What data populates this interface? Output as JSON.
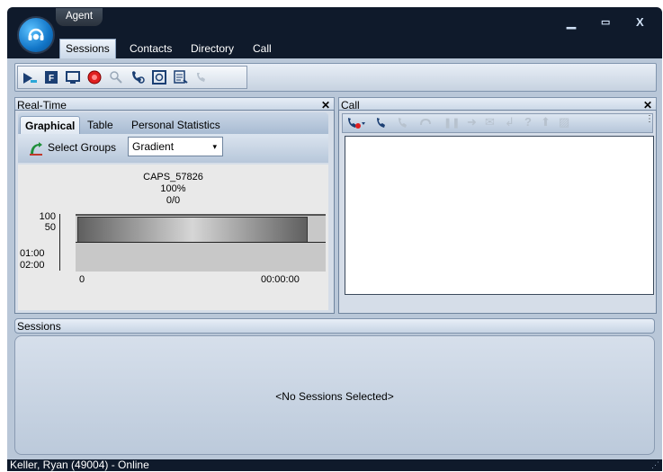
{
  "app": {
    "title": "Agent"
  },
  "menu_tabs": [
    "Sessions",
    "Contacts",
    "Directory",
    "Call Log"
  ],
  "realtime": {
    "header": "Real-Time",
    "subtabs": [
      "Graphical",
      "Table",
      "Personal Statistics"
    ],
    "select_groups_label": "Select Groups",
    "combo_value": "Gradient",
    "graph": {
      "name": "CAPS_57826",
      "percent": "100%",
      "ratio": "0/0",
      "y_ticks": [
        "100",
        "50",
        "01:00",
        "02:00"
      ],
      "x_left": "0",
      "x_right": "00:00:00"
    }
  },
  "call": {
    "header": "Call"
  },
  "sessions": {
    "header": "Sessions",
    "empty_text": "<No Sessions Selected>"
  },
  "status": {
    "text": "Keller, Ryan (49004) - Online"
  },
  "colors": {
    "window_dark": "#0f1a2b",
    "band": "#b9c7d8",
    "record_red": "#e02020",
    "accent_blue": "#1276c8"
  }
}
